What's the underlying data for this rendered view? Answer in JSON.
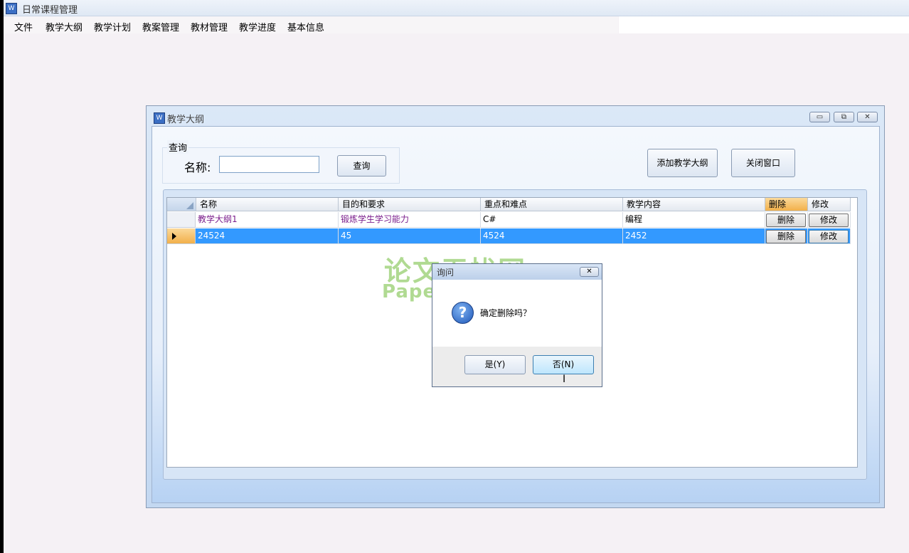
{
  "app": {
    "title": "日常课程管理",
    "icon": "app-icon"
  },
  "menu": [
    "文件",
    "教学大纲",
    "教学计划",
    "教案管理",
    "教材管理",
    "教学进度",
    "基本信息"
  ],
  "child_window": {
    "title": "教学大纲",
    "search": {
      "group_label": "查询",
      "name_label": "名称:",
      "input_value": "",
      "query_button": "查询"
    },
    "add_button": "添加教学大纲",
    "close_button": "关闭窗口",
    "grid": {
      "columns": [
        "名称",
        "目的和要求",
        "重点和难点",
        "教学内容",
        "删除",
        "修改"
      ],
      "rows": [
        {
          "name": "教学大纲1",
          "purpose": "锻炼学生学习能力",
          "key_points": "C#",
          "content": "编程",
          "delete": "删除",
          "edit": "修改",
          "selected": false
        },
        {
          "name": "24524",
          "purpose": "45",
          "key_points": "4524",
          "content": "2452",
          "delete": "删除",
          "edit": "修改",
          "selected": true
        }
      ]
    }
  },
  "watermark": {
    "line1": "论文无忧网",
    "line2": "Paper51.com"
  },
  "dialog": {
    "title": "询问",
    "message": "确定删除吗？",
    "icon": "question-icon",
    "yes_button": "是(Y)",
    "no_button": "否(N)"
  },
  "colors": {
    "selection": "#3399ff",
    "row_text": "#7b1e8c",
    "header_highlight": "#f7c46c"
  }
}
